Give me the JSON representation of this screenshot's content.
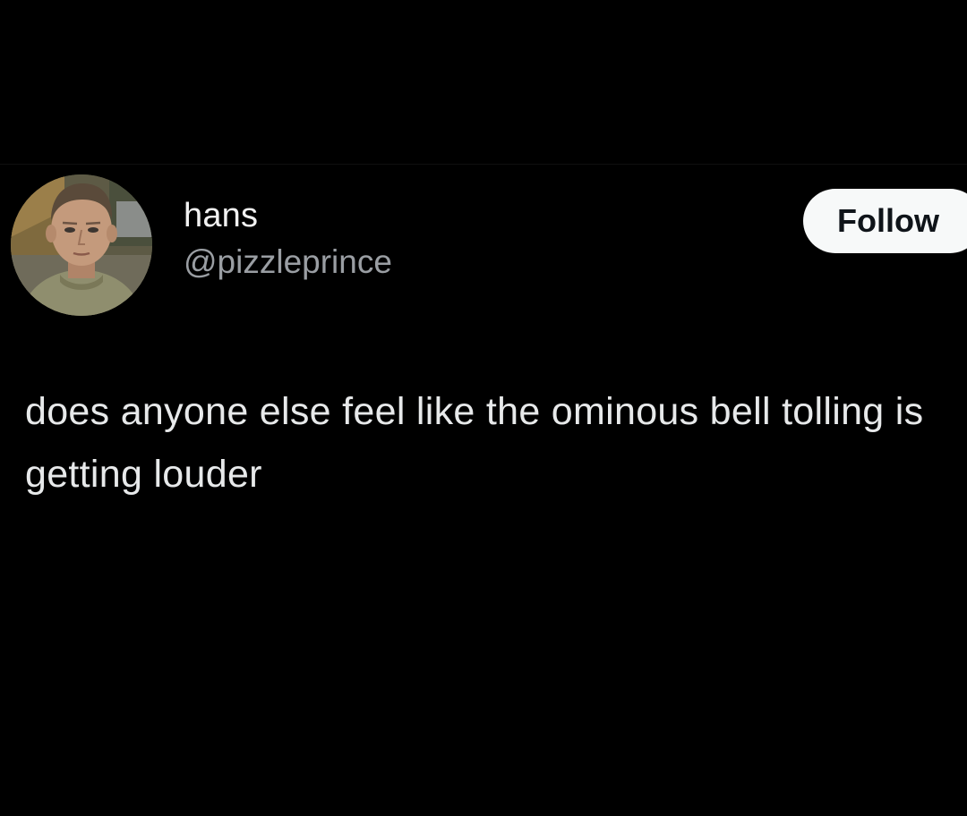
{
  "post": {
    "author": {
      "display_name": "hans",
      "handle": "@pizzleprince",
      "avatar_icon": "user-avatar"
    },
    "follow_label": "Follow",
    "text": "does anyone else feel like the ominous bell tolling is getting louder"
  },
  "colors": {
    "background": "#000000",
    "primary_text": "#e7e9ea",
    "secondary_text": "#9a9ea3",
    "follow_bg": "#f7f9f9",
    "follow_text": "#0f1419"
  }
}
